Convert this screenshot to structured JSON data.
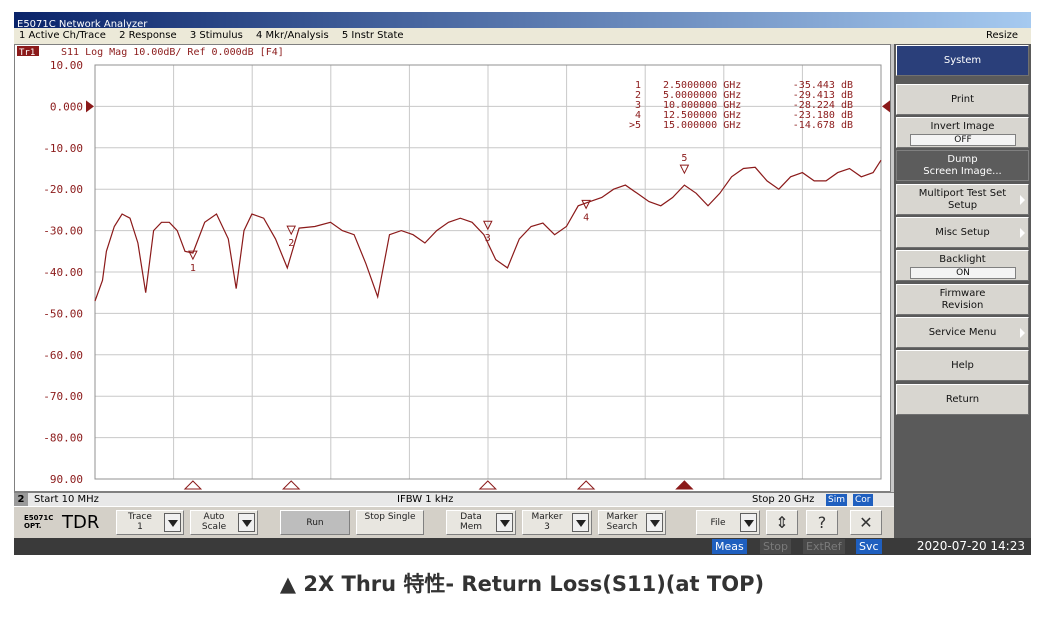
{
  "window": {
    "title": "E5071C Network Analyzer"
  },
  "menu": [
    "1 Active Ch/Trace",
    "2 Response",
    "3 Stimulus",
    "4 Mkr/Analysis",
    "5 Instr State"
  ],
  "menu_right": "Resize",
  "trace": {
    "tag": "Tr1",
    "header": "S11 Log Mag 10.00dB/ Ref 0.000dB [F4]",
    "color": "#8b1a1a"
  },
  "axis": {
    "y_ticks": [
      "10.00",
      "0.000",
      "-10.00",
      "-20.00",
      "-30.00",
      "-40.00",
      "-50.00",
      "-60.00",
      "-70.00",
      "-80.00",
      "90.00"
    ]
  },
  "marker_table": [
    {
      "id": "1",
      "freq": "2.5000000 GHz",
      "val": "-35.443 dB"
    },
    {
      "id": "2",
      "freq": "5.0000000 GHz",
      "val": "-29.413 dB"
    },
    {
      "id": "3",
      "freq": "10.000000 GHz",
      "val": "-28.224 dB"
    },
    {
      "id": "4",
      "freq": "12.500000 GHz",
      "val": "-23.180 dB"
    },
    {
      "id": ">5",
      "freq": "15.000000 GHz",
      "val": "-14.678 dB"
    }
  ],
  "chart_data": {
    "type": "line",
    "xlabel": "",
    "ylabel": "",
    "xlim": [
      0.01,
      20
    ],
    "ylim": [
      -90,
      10
    ],
    "grid": true,
    "series": [
      {
        "x": [
          0.01,
          0.2,
          0.3,
          0.5,
          0.7,
          0.9,
          1.1,
          1.3,
          1.5,
          1.7,
          1.9,
          2.1,
          2.3,
          2.5,
          2.8,
          3.1,
          3.4,
          3.6,
          3.8,
          4.0,
          4.3,
          4.6,
          4.9,
          5.2,
          5.6,
          6.0,
          6.3,
          6.6,
          6.9,
          7.2,
          7.5,
          7.8,
          8.1,
          8.4,
          8.7,
          9.0,
          9.3,
          9.6,
          9.9,
          10.2,
          10.5,
          10.8,
          11.1,
          11.4,
          11.7,
          12.0,
          12.3,
          12.6,
          12.9,
          13.2,
          13.5,
          13.8,
          14.1,
          14.4,
          14.7,
          15.0,
          15.3,
          15.6,
          15.9,
          16.2,
          16.5,
          16.8,
          17.1,
          17.4,
          17.7,
          18.0,
          18.3,
          18.6,
          18.9,
          19.2,
          19.5,
          19.8,
          20.0
        ],
        "y": [
          -47,
          -42,
          -35,
          -29,
          -26,
          -27,
          -33,
          -45,
          -30,
          -28,
          -28,
          -30,
          -35,
          -35.4,
          -28,
          -26,
          -32,
          -44,
          -30,
          -26,
          -27,
          -32,
          -39,
          -29.4,
          -29,
          -28,
          -30,
          -31,
          -38,
          -46,
          -31,
          -30,
          -31,
          -33,
          -30,
          -28,
          -27,
          -28,
          -31,
          -37,
          -39,
          -32,
          -29,
          -28.2,
          -31,
          -29,
          -24,
          -23,
          -22,
          -20,
          -19,
          -21,
          -23,
          -24,
          -22,
          -19,
          -21,
          -24,
          -21,
          -17,
          -15,
          -14.7,
          -18,
          -20,
          -17,
          -16,
          -18,
          -18,
          -16,
          -15,
          -17,
          -16,
          -13
        ]
      }
    ],
    "markers": [
      {
        "id": "1",
        "x": 2.5,
        "y": -35.443
      },
      {
        "id": "2",
        "x": 5.0,
        "y": -29.413
      },
      {
        "id": "3",
        "x": 10.0,
        "y": -28.224
      },
      {
        "id": "4",
        "x": 12.5,
        "y": -23.18
      },
      {
        "id": "5",
        "x": 15.0,
        "y": -14.678
      }
    ],
    "bottom_triangles_x": [
      2.5,
      5.0,
      10.0,
      12.5,
      15.0
    ]
  },
  "status": {
    "channel": "2",
    "start": "Start 10 MHz",
    "ifbw": "IFBW 1 kHz",
    "stop": "Stop 20 GHz",
    "sim": "Sim",
    "cor": "Cor"
  },
  "brand": {
    "model": "E5071C",
    "option": "OPT.",
    "tdr": "TDR"
  },
  "softkeys": [
    {
      "name": "trace",
      "label": "Trace\n1"
    },
    {
      "name": "auto-scale",
      "label": "Auto\nScale"
    },
    {
      "name": "run",
      "label": "Run"
    },
    {
      "name": "stop-single",
      "label": "Stop\nSingle"
    },
    {
      "name": "data-mem",
      "label": "Data\nMem"
    },
    {
      "name": "marker",
      "label": "Marker\n3"
    },
    {
      "name": "marker-search",
      "label": "Marker\nSearch"
    },
    {
      "name": "file",
      "label": "File"
    }
  ],
  "bottom_status": {
    "meas": "Meas",
    "stop": "Stop",
    "extref": "ExtRef",
    "svc": "Svc",
    "datetime": "2020-07-20 14:23"
  },
  "panel": {
    "title": "System",
    "items": [
      {
        "name": "print",
        "label": "Print"
      },
      {
        "name": "invert-image",
        "label": "Invert Image",
        "value": "OFF"
      },
      {
        "name": "dump-screen",
        "label": "Dump\nScreen Image..."
      },
      {
        "name": "multiport-test-set-setup",
        "label": "Multiport Test Set\nSetup"
      },
      {
        "name": "misc-setup",
        "label": "Misc Setup"
      },
      {
        "name": "backlight",
        "label": "Backlight",
        "value": "ON"
      },
      {
        "name": "firmware-revision",
        "label": "Firmware\nRevision"
      },
      {
        "name": "service-menu",
        "label": "Service Menu"
      },
      {
        "name": "help",
        "label": "Help"
      },
      {
        "name": "return",
        "label": "Return"
      }
    ]
  },
  "caption": "▲ 2X Thru 特性- Return Loss(S11)(at TOP)",
  "colors": {
    "trace": "#8b1a1a",
    "panel_head": "#2a3f7a",
    "app_bg": "#d4d0c8",
    "status_badge": "#1f5fbf"
  }
}
